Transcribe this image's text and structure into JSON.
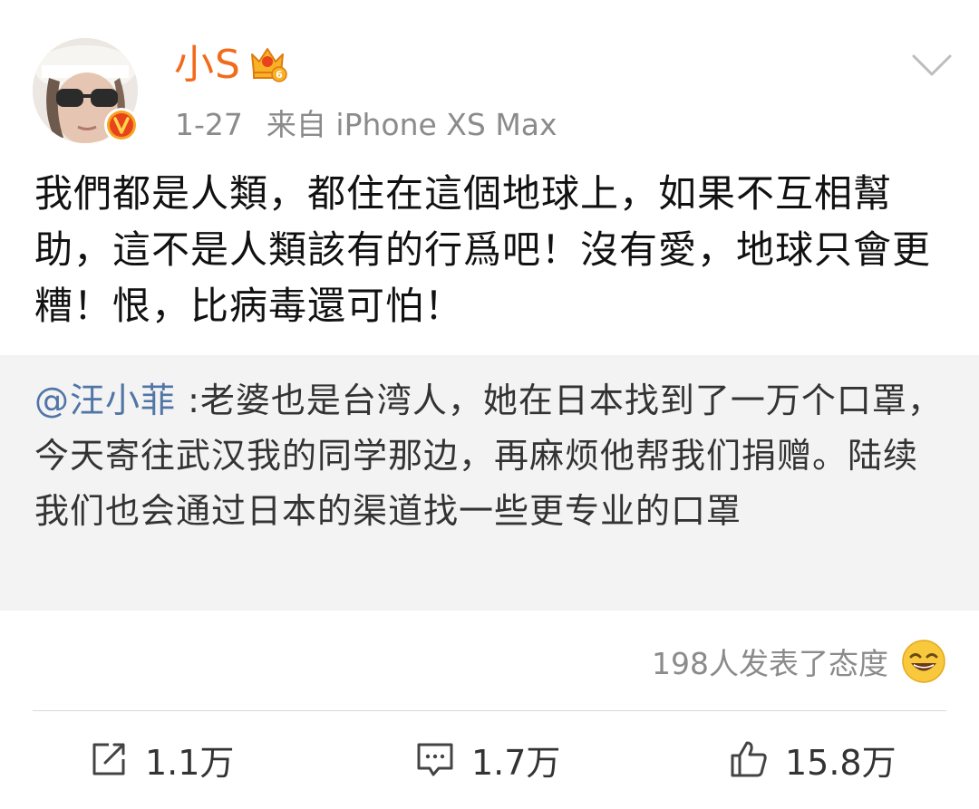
{
  "post": {
    "username": "小S",
    "date": "1-27",
    "source": "来自 iPhone XS Max",
    "text": "我們都是人類，都住在這個地球上，如果不互相幫助，這不是人類該有的行爲吧！沒有愛，地球只會更糟！恨，比病毒還可怕！"
  },
  "quote": {
    "mention": "@汪小菲",
    "text": " :老婆也是台湾人，她在日本找到了一万个口罩，今天寄往武汉我的同学那边，再麻烦他帮我们捐赠。陆续我们也会通过日本的渠道找一些更专业的口罩"
  },
  "reactions": {
    "text": "198人发表了态度"
  },
  "actions": {
    "repost_count": "1.1万",
    "comment_count": "1.7万",
    "like_count": "15.8万"
  },
  "colors": {
    "username": "#f26b1d",
    "mention": "#5075a6",
    "quote_bg": "#f3f3f3",
    "meta": "#8b8b8b"
  },
  "icons": [
    "avatar",
    "verified-badge-icon",
    "vip-crown-icon",
    "chevron-down-icon",
    "laughing-emoji-icon",
    "repost-icon",
    "comment-icon",
    "like-icon"
  ]
}
